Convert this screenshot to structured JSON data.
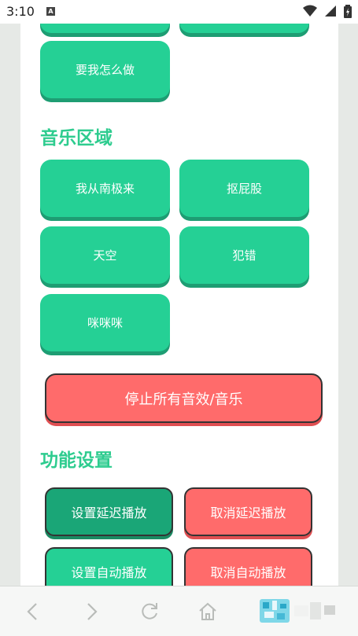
{
  "status_bar": {
    "time": "3:10",
    "notification_letter": "A"
  },
  "top_buttons": {
    "make_me_do": "要我怎么做"
  },
  "music": {
    "title": "音乐区域",
    "buttons": [
      "我从南极来",
      "抠屁股",
      "天空",
      "犯错",
      "咪咪咪"
    ]
  },
  "stop_all": "停止所有音效/音乐",
  "settings": {
    "title": "功能设置",
    "set_delay": "设置延迟播放",
    "cancel_delay": "取消延迟播放",
    "set_auto": "设置自动播放",
    "cancel_auto": "取消自动播放"
  },
  "colors": {
    "green": "#25d095",
    "green_shadow": "#1e9d73",
    "red": "#ff6b6b",
    "title_green": "#2ecc8f"
  },
  "nav_icons": [
    "back-icon",
    "forward-icon",
    "refresh-icon",
    "home-icon",
    "qr-overlay-icon"
  ]
}
